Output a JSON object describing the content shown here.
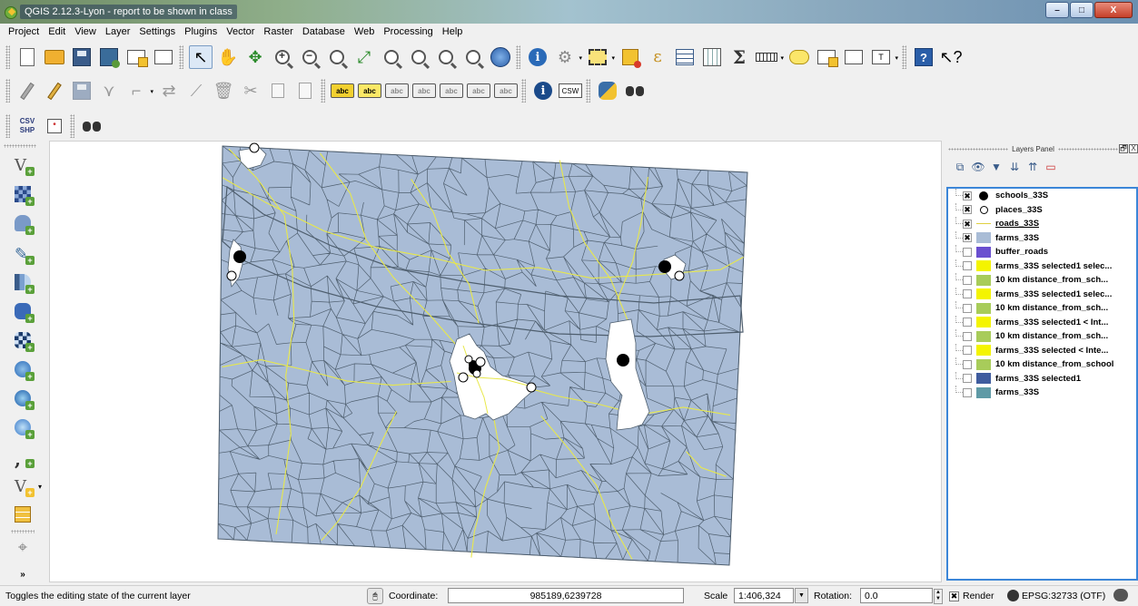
{
  "window": {
    "title": "QGIS 2.12.3-Lyon - report to be shown in class",
    "minimize": "–",
    "maximize": "□",
    "close": "X"
  },
  "menu": [
    "Project",
    "Edit",
    "View",
    "Layer",
    "Settings",
    "Plugins",
    "Vector",
    "Raster",
    "Database",
    "Web",
    "Processing",
    "Help"
  ],
  "toolbar3": {
    "csv_shp_line1": "CSV",
    "csv_shp_line2": "SHP"
  },
  "toolbar2_labels": {
    "abc": "abc",
    "csw": "CSW"
  },
  "layers_panel": {
    "title": "Layers Panel",
    "float": "🗗",
    "close": "X",
    "layers": [
      {
        "name": "schools_33S",
        "checked": true,
        "symbol": "black-dot"
      },
      {
        "name": "places_33S",
        "checked": true,
        "symbol": "white-dot"
      },
      {
        "name": "roads_33S",
        "checked": true,
        "symbol": "yellow-line",
        "underline": true
      },
      {
        "name": "farms_33S",
        "checked": true,
        "symbol": "fill",
        "color": "#a9bcd6"
      },
      {
        "name": "buffer_roads",
        "checked": false,
        "symbol": "fill",
        "color": "#6a4fd0"
      },
      {
        "name": "farms_33S selected1 selec...",
        "checked": false,
        "symbol": "fill",
        "color": "#f4f400"
      },
      {
        "name": "10 km distance_from_sch...",
        "checked": false,
        "symbol": "fill",
        "color": "#a8cc5a"
      },
      {
        "name": "farms_33S selected1 selec...",
        "checked": false,
        "symbol": "fill",
        "color": "#f4f400"
      },
      {
        "name": "10 km distance_from_sch...",
        "checked": false,
        "symbol": "fill",
        "color": "#a8cc5a"
      },
      {
        "name": "farms_33S selected1 < Int...",
        "checked": false,
        "symbol": "fill",
        "color": "#f4f400"
      },
      {
        "name": "10 km distance_from_sch...",
        "checked": false,
        "symbol": "fill",
        "color": "#a8cc5a"
      },
      {
        "name": "farms_33S selected < Inte...",
        "checked": false,
        "symbol": "fill",
        "color": "#f4f400"
      },
      {
        "name": "10 km distance_from_school",
        "checked": false,
        "symbol": "fill",
        "color": "#a8cc5a"
      },
      {
        "name": "farms_33S selected1",
        "checked": false,
        "symbol": "fill",
        "color": "#3f5c9e"
      },
      {
        "name": "farms_33S",
        "checked": false,
        "symbol": "fill",
        "color": "#5f9aa6"
      }
    ]
  },
  "map": {
    "farm_fill": "#a9bcd6",
    "farm_stroke": "#4e5e6e",
    "road_color": "#e8e84a",
    "buffer_fill": "#ffffff"
  },
  "status": {
    "message": "Toggles the editing state of the current layer",
    "coordinate_label": "Coordinate:",
    "coordinate_value": "985189,6239728",
    "scale_label": "Scale",
    "scale_value": "1:406,324",
    "rotation_label": "Rotation:",
    "rotation_value": "0.0",
    "render_label": "Render",
    "crs": "EPSG:32733 (OTF)"
  }
}
